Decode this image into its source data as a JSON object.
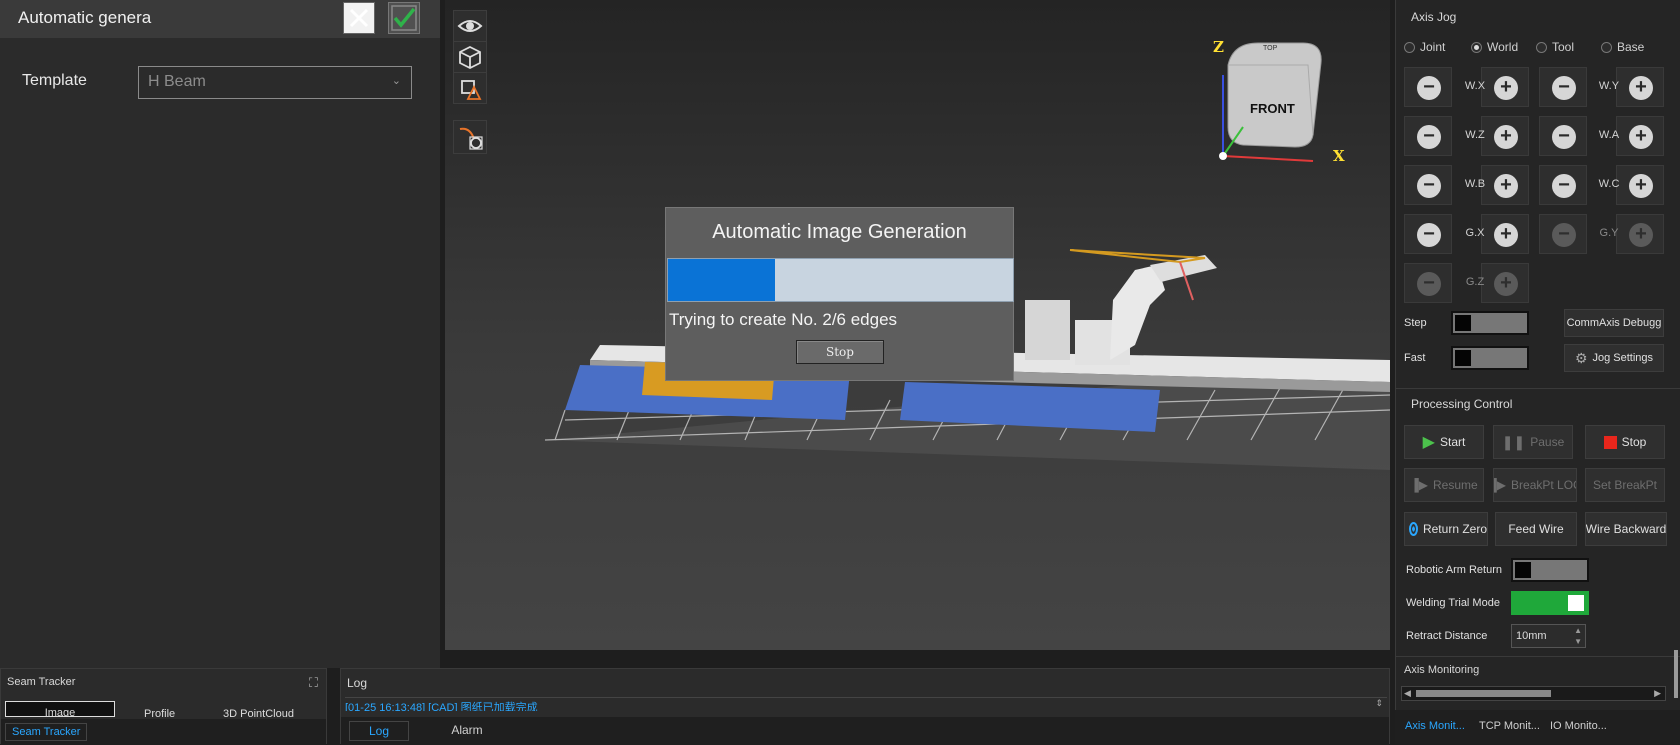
{
  "left_panel": {
    "title": "Automatic genera",
    "template_label": "Template",
    "template_value": "H Beam"
  },
  "toolbar": {
    "icons": [
      "eye-icon",
      "cube-icon",
      "cube-warning-icon",
      "path-settings-icon"
    ]
  },
  "view_cube": {
    "face_label": "FRONT",
    "top_label": "TOP",
    "axis_z": "Z",
    "axis_x": "X"
  },
  "dialog": {
    "title": "Automatic Image Generation",
    "progress_fraction": 0.31,
    "status": "Trying to create No. 2/6 edges",
    "stop_label": "Stop"
  },
  "axis_jog": {
    "title": "Axis Jog",
    "modes": [
      {
        "label": "Joint",
        "selected": false
      },
      {
        "label": "World",
        "selected": true
      },
      {
        "label": "Tool",
        "selected": false
      },
      {
        "label": "Base",
        "selected": false
      }
    ],
    "rows": [
      [
        {
          "label": "W.X",
          "enabled": true
        },
        {
          "label": "W.Y",
          "enabled": true
        }
      ],
      [
        {
          "label": "W.Z",
          "enabled": true
        },
        {
          "label": "W.A",
          "enabled": true
        }
      ],
      [
        {
          "label": "W.B",
          "enabled": true
        },
        {
          "label": "W.C",
          "enabled": true
        }
      ],
      [
        {
          "label": "G.X",
          "enabled": true
        },
        {
          "label": "G.Y",
          "enabled": false
        }
      ],
      [
        {
          "label": "G.Z",
          "enabled": false
        }
      ]
    ],
    "step_label": "Step",
    "fast_label": "Fast",
    "commaxis_label": "CommAxis Debugg",
    "jog_settings_label": "Jog Settings"
  },
  "processing": {
    "title": "Processing Control",
    "start": "Start",
    "pause": "Pause",
    "stop": "Stop",
    "resume": "Resume",
    "breakpt_loc": "BreakPt LOC",
    "set_breakpt": "Set BreakPt",
    "return_zero": "Return Zero",
    "feed_wire": "Feed Wire",
    "wire_backward": "Wire Backward",
    "robotic_arm_return": "Robotic Arm Return",
    "welding_trial_mode": "Welding Trial Mode",
    "retract_distance": "Retract Distance",
    "retract_value": "10mm"
  },
  "axis_monitoring": {
    "title": "Axis Monitoring",
    "tabs": [
      "Axis Monit...",
      "TCP Monit...",
      "IO Monito..."
    ]
  },
  "seam_tracker": {
    "title": "Seam Tracker",
    "subtabs": [
      "Image",
      "Profile",
      "3D PointCloud"
    ],
    "tab": "Seam Tracker"
  },
  "log": {
    "title": "Log",
    "line": "[01-25 16:13:48] [CAD] 图纸已加载完成",
    "tabs": [
      "Log",
      "Alarm"
    ]
  },
  "colors": {
    "progress": "#0a73d6",
    "accent_tab": "#2aa7ff",
    "stop_red": "#e8261c",
    "start_green": "#4cc24c",
    "toggle_on": "#1fa83a"
  }
}
